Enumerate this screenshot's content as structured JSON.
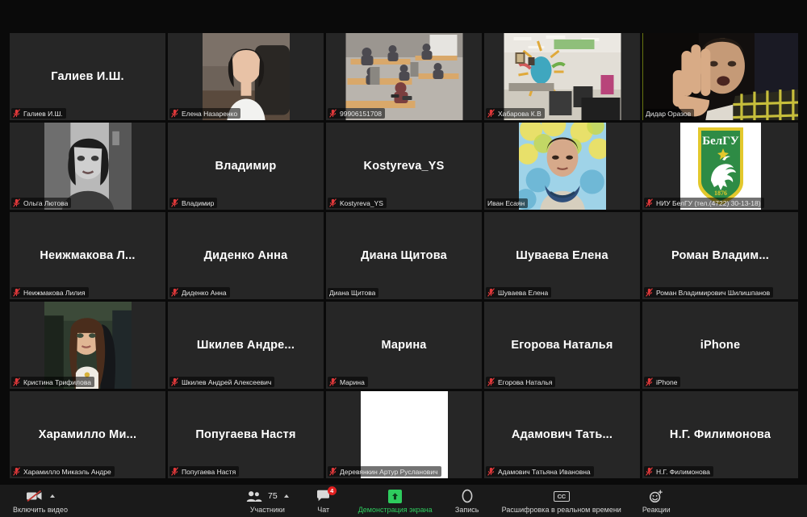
{
  "app": {
    "name": "Zoom Meeting",
    "view": "gallery-view",
    "background": "#0a0a0a",
    "active_speaker_border": "#c3e018"
  },
  "gallery": {
    "columns": 5,
    "rows": 5,
    "tiles": [
      {
        "display_name": "Галиев И.Ш.",
        "label": "Галиев И.Ш.",
        "muted": true,
        "video": "off",
        "active_speaker": false
      },
      {
        "display_name": "",
        "label": "Елена Назаренко",
        "muted": true,
        "video": "on",
        "video_kind": "woman-office-white-shirt",
        "active_speaker": false
      },
      {
        "display_name": "",
        "label": "99906151708",
        "muted": true,
        "video": "on",
        "video_kind": "classroom-students-desks",
        "active_speaker": false
      },
      {
        "display_name": "",
        "label": "Хабарова К.В",
        "muted": true,
        "video": "on",
        "video_kind": "office-room-mural",
        "active_speaker": false
      },
      {
        "display_name": "",
        "label": "Дидар Оразов",
        "muted": false,
        "video": "on",
        "video_kind": "man-plaid-shirt-hand",
        "active_speaker": true
      },
      {
        "display_name": "",
        "label": "Ольга Лютова",
        "muted": true,
        "video": "on",
        "video_kind": "woman-bw-portrait",
        "active_speaker": false
      },
      {
        "display_name": "Владимир",
        "label": "Владимир",
        "muted": true,
        "video": "off",
        "active_speaker": false
      },
      {
        "display_name": "Kostyreva_YS",
        "label": "Kostyreva_YS",
        "muted": true,
        "video": "off",
        "active_speaker": false
      },
      {
        "display_name": "",
        "label": "Иван Есаян",
        "muted": false,
        "video": "on",
        "video_kind": "man-autumn-leaves-scarf",
        "active_speaker": false
      },
      {
        "display_name": "",
        "label": "НИУ БелГУ (тел.(4722) 30-13-18)",
        "muted": true,
        "video": "on",
        "video_kind": "belgu-logo-shield",
        "active_speaker": false
      },
      {
        "display_name": "Неижмакова  Л...",
        "label": "Неижмакова Лилия",
        "muted": true,
        "video": "off",
        "active_speaker": false
      },
      {
        "display_name": "Диденко Анна",
        "label": "Диденко Анна",
        "muted": true,
        "video": "off",
        "active_speaker": false
      },
      {
        "display_name": "Диана Щитова",
        "label": "Диана Щитова",
        "muted": false,
        "video": "off",
        "active_speaker": false
      },
      {
        "display_name": "Шуваева Елена",
        "label": "Шуваева Елена",
        "muted": true,
        "video": "off",
        "active_speaker": false
      },
      {
        "display_name": "Роман  Владим...",
        "label": "Роман Владимирович Шилишпанов",
        "muted": true,
        "video": "off",
        "active_speaker": false
      },
      {
        "display_name": "",
        "label": "Кристина Трифилова",
        "muted": true,
        "video": "on",
        "video_kind": "young-woman-long-hair-car",
        "active_speaker": false
      },
      {
        "display_name": "Шкилев  Андре...",
        "label": "Шкилев Андрей Алексеевич",
        "muted": true,
        "video": "off",
        "active_speaker": false
      },
      {
        "display_name": "Марина",
        "label": "Марина",
        "muted": true,
        "video": "off",
        "active_speaker": false
      },
      {
        "display_name": "Егорова Наталья",
        "label": "Егорова Наталья",
        "muted": true,
        "video": "off",
        "active_speaker": false
      },
      {
        "display_name": "iPhone",
        "label": "iPhone",
        "muted": true,
        "video": "off",
        "active_speaker": false
      },
      {
        "display_name": "Харамилло  Ми...",
        "label": "Харамилло Микаэль Андре",
        "muted": true,
        "video": "off",
        "active_speaker": false
      },
      {
        "display_name": "Попугаева Настя",
        "label": "Попугаева Настя",
        "muted": true,
        "video": "off",
        "active_speaker": false
      },
      {
        "display_name": "",
        "label": "Деревянкин Артур Русланович",
        "muted": true,
        "video": "on",
        "video_kind": "blank-white-screen",
        "active_speaker": false
      },
      {
        "display_name": "Адамович  Тать...",
        "label": "Адамович Татьяна Ивановна",
        "muted": true,
        "video": "off",
        "active_speaker": false
      },
      {
        "display_name": "Н.Г. Филимонова",
        "label": "Н.Г. Филимонова",
        "muted": true,
        "video": "off",
        "active_speaker": false
      }
    ]
  },
  "toolbar": {
    "video": {
      "label": "Включить видео",
      "icon": "video-off-icon",
      "has_caret": true
    },
    "participants": {
      "label": "Участники",
      "count": "75",
      "icon": "participants-icon",
      "has_caret": true
    },
    "chat": {
      "label": "Чат",
      "icon": "chat-icon",
      "badge": "4",
      "badge_color": "#e02020"
    },
    "share": {
      "label": "Демонстрация экрана",
      "icon": "share-screen-icon",
      "color": "#2ecc5e"
    },
    "record": {
      "label": "Запись",
      "icon": "record-icon"
    },
    "transcription": {
      "label": "Расшифровка в реальном времени",
      "icon": "closed-caption-icon",
      "cc_text": "CC"
    },
    "reactions": {
      "label": "Реакции",
      "icon": "reactions-icon"
    }
  }
}
